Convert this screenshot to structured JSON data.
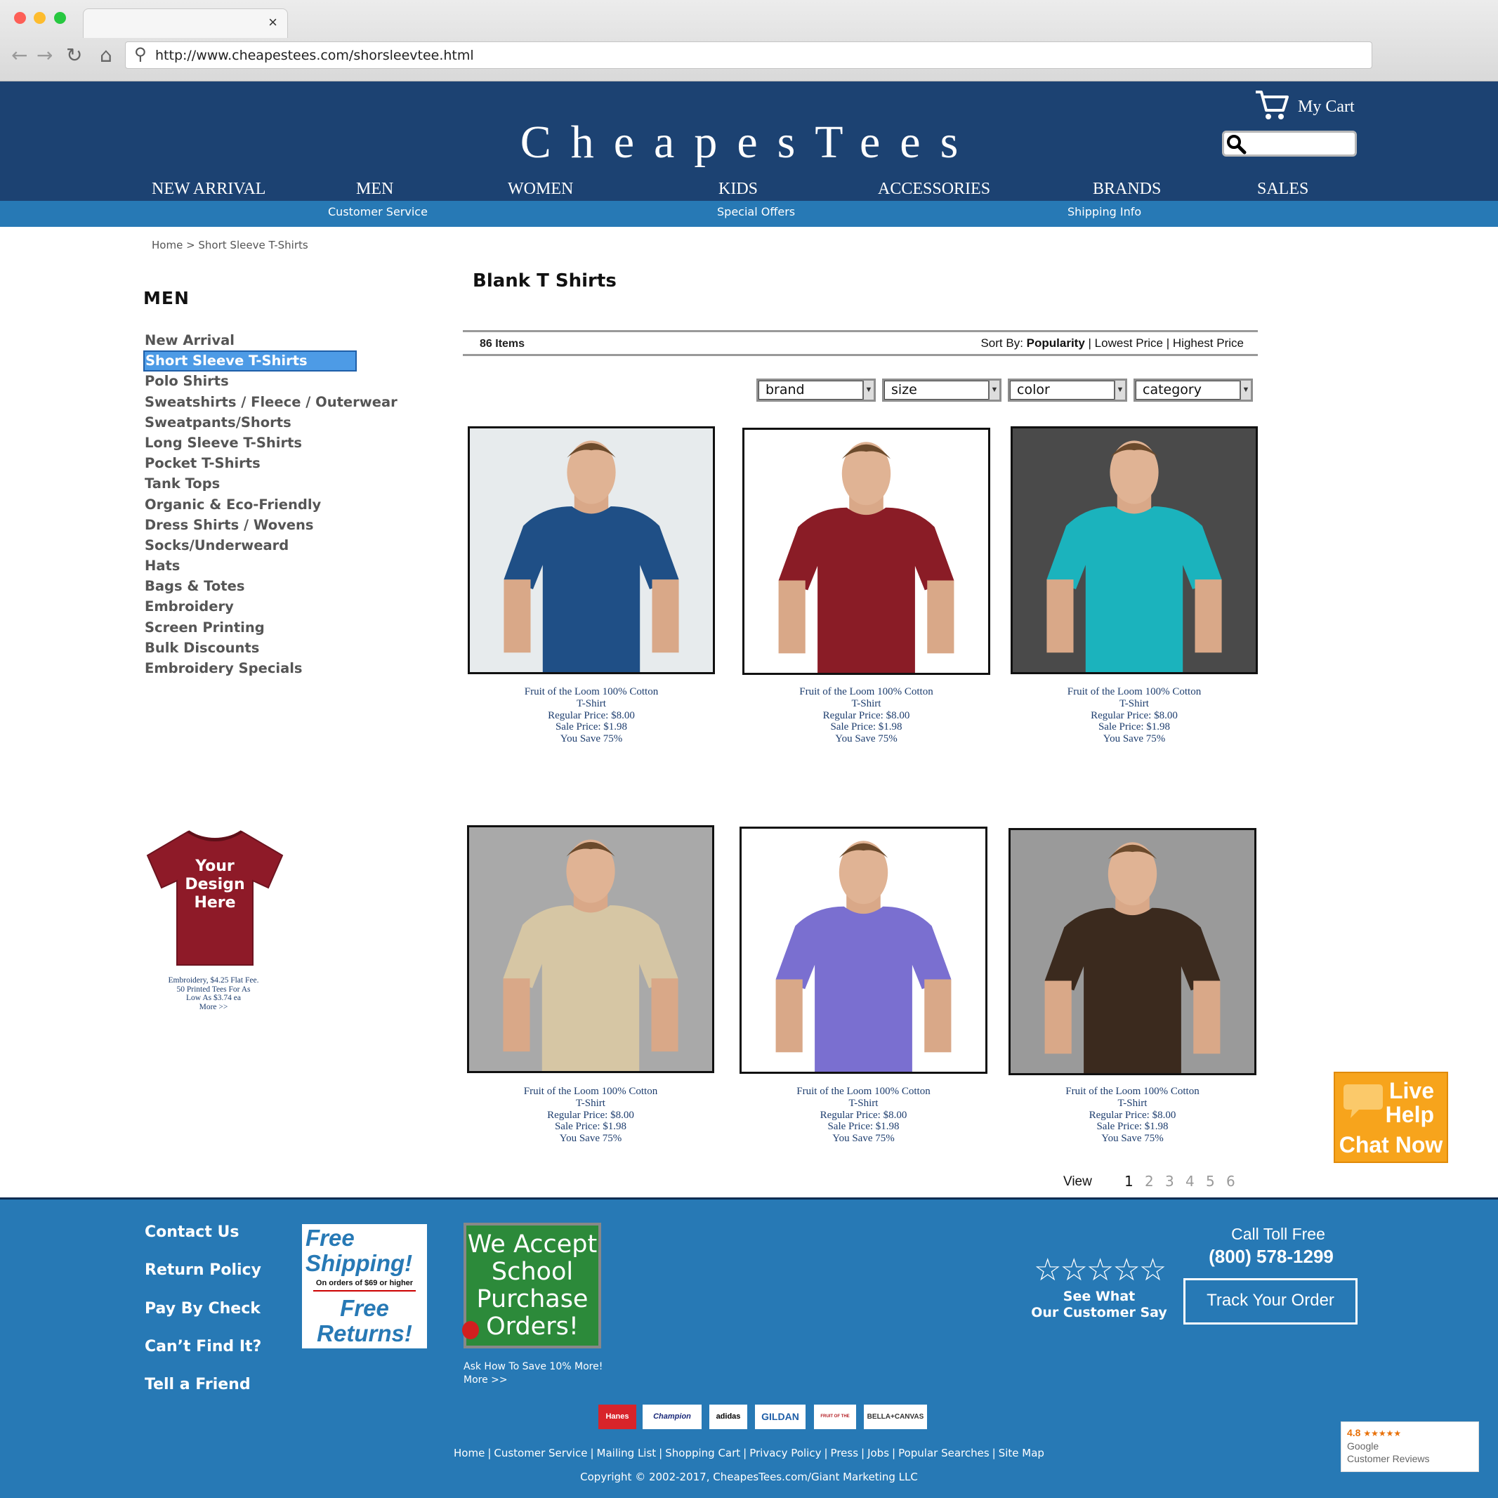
{
  "browser": {
    "tab_close": "×",
    "back": "←",
    "forward": "→",
    "reload": "↻",
    "home": "⌂",
    "url": "http://www.cheapestees.com/shorsleevtee.html"
  },
  "header": {
    "logo": "CheapesTees",
    "cart_label": "My Cart",
    "search_placeholder": "",
    "nav": [
      "NEW ARRIVAL",
      "MEN",
      "WOMEN",
      "KIDS",
      "ACCESSORIES",
      "BRANDS",
      "SALES"
    ],
    "subnav": [
      "Customer Service",
      "Special Offers",
      "Shipping Info"
    ]
  },
  "breadcrumb": "Home > Short Sleeve T-Shirts",
  "sidebar": {
    "title": "MEN",
    "items": [
      "New Arrival",
      "Short Sleeve T-Shirts",
      "Polo Shirts",
      "Sweatshirts / Fleece / Outerwear",
      "Sweatpants/Shorts",
      "Long Sleeve T-Shirts",
      "Pocket T-Shirts",
      "Tank Tops",
      "Organic & Eco-Friendly",
      "Dress Shirts / Wovens",
      "Socks/Underweard",
      "Hats",
      "Bags & Totes",
      "Embroidery",
      "Screen Printing",
      "Bulk Discounts",
      "Embroidery Specials"
    ],
    "selected_index": 1,
    "promo": {
      "shirt_text": [
        "Your",
        "Design",
        "Here"
      ],
      "caption": [
        "Embroidery, $4.25 Flat Fee.",
        "50 Printed Tees For As",
        "Low As $3.74 ea",
        "More >>"
      ]
    }
  },
  "main": {
    "title": "Blank T Shirts",
    "item_count": "86 Items",
    "sort_label": "Sort By:",
    "sort_options": [
      "Popularity",
      "Lowest Price",
      "Highest Price"
    ],
    "sort_sep": "|",
    "filters": [
      "brand",
      "size",
      "color",
      "category"
    ],
    "products": [
      {
        "name": "Fruit of the Loom 100% Cotton",
        "type": "T-Shirt",
        "regular": "Regular Price: $8.00",
        "sale": "Sale Price: $1.98",
        "save": "You Save 75%",
        "shirt_color": "#1f4f86",
        "bg": "#e7ebed"
      },
      {
        "name": "Fruit of the Loom 100% Cotton",
        "type": "T-Shirt",
        "regular": "Regular Price: $8.00",
        "sale": "Sale Price: $1.98",
        "save": "You Save 75%",
        "shirt_color": "#8a1c26",
        "bg": "#ffffff"
      },
      {
        "name": "Fruit of the Loom 100% Cotton",
        "type": "T-Shirt",
        "regular": "Regular Price: $8.00",
        "sale": "Sale Price: $1.98",
        "save": "You Save 75%",
        "shirt_color": "#1bb3bd",
        "bg": "#4a4a4a"
      },
      {
        "name": "Fruit of the Loom 100% Cotton",
        "type": "T-Shirt",
        "regular": "Regular Price: $8.00",
        "sale": "Sale Price: $1.98",
        "save": "You Save 75%",
        "shirt_color": "#d6c6a4",
        "bg": "#a9a9a9"
      },
      {
        "name": "Fruit of the Loom 100% Cotton",
        "type": "T-Shirt",
        "regular": "Regular Price: $8.00",
        "sale": "Sale Price: $1.98",
        "save": "You Save 75%",
        "shirt_color": "#7a6fd0",
        "bg": "#ffffff"
      },
      {
        "name": "Fruit of the Loom 100% Cotton",
        "type": "T-Shirt",
        "regular": "Regular Price: $8.00",
        "sale": "Sale Price: $1.98",
        "save": "You Save 75%",
        "shirt_color": "#3b2a1e",
        "bg": "#9a9a9a"
      }
    ],
    "pagination": {
      "label": "View",
      "pages": [
        "1",
        "2",
        "3",
        "4",
        "5",
        "6"
      ],
      "current": "1"
    }
  },
  "live_help": {
    "line1": "Live",
    "line2": "Help",
    "line3": "Chat Now"
  },
  "footer": {
    "links": [
      "Contact Us",
      "Return Policy",
      "Pay By Check",
      "Can’t Find It?",
      "Tell a Friend"
    ],
    "free_shipping": {
      "title": "Free Shipping!",
      "sub": "On orders of $69 or higher",
      "returns": "Free Returns!"
    },
    "school": {
      "text": "We Accept School Purchase Orders!",
      "note1": "Ask How To Save 10% More!",
      "note2": "More >>"
    },
    "stars": "☆☆☆☆☆",
    "reviews": [
      "See What",
      "Our Customer Say"
    ],
    "call_label": "Call Toll Free",
    "phone": "(800) 578-1299",
    "track": "Track Your Order",
    "brands": [
      "Hanes",
      "Champion",
      "adidas",
      "GILDAN",
      "FRUIT OF THE LOOM",
      "BELLA+CANVAS"
    ],
    "bottom_links": [
      "Home",
      "Customer Service",
      "Mailing List",
      "Shopping Cart",
      "Privacy Policy",
      "Press",
      "Jobs",
      "Popular Searches",
      "Site Map"
    ],
    "copyright": "Copyright © 2002-2017, CheapesTees.com/Giant Marketing LLC",
    "google": {
      "rating": "4.8",
      "stars": "★★★★★",
      "line1": "Google",
      "line2": "Customer Reviews"
    }
  },
  "colors": {
    "header": "#1c4272",
    "subbar": "#2779b5",
    "footer": "#2779b5",
    "accent": "#f7a41c"
  }
}
